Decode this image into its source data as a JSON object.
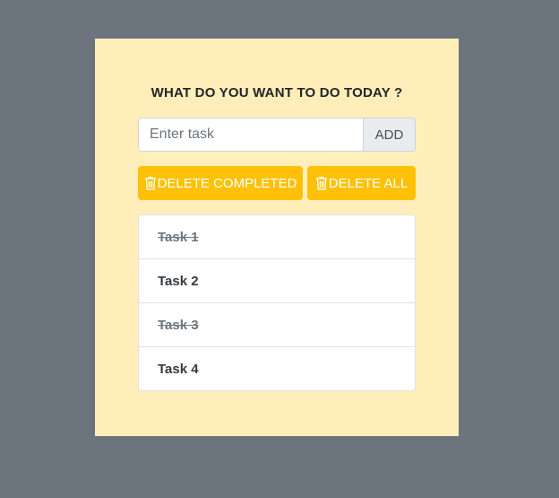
{
  "card": {
    "title": "WHAT DO YOU WANT TO DO TODAY ?",
    "background": "#ffeeba"
  },
  "input": {
    "placeholder": "Enter task",
    "value": "",
    "add_label": "ADD"
  },
  "buttons": {
    "delete_completed": {
      "label": "DELETE COMPLETED",
      "icon": "trash-icon"
    },
    "delete_all": {
      "label": "DELETE ALL",
      "icon": "trash-icon"
    },
    "color": "#ffc107"
  },
  "tasks": [
    {
      "label": "Task 1",
      "completed": true
    },
    {
      "label": "Task 2",
      "completed": false
    },
    {
      "label": "Task 3",
      "completed": true
    },
    {
      "label": "Task 4",
      "completed": false
    }
  ]
}
